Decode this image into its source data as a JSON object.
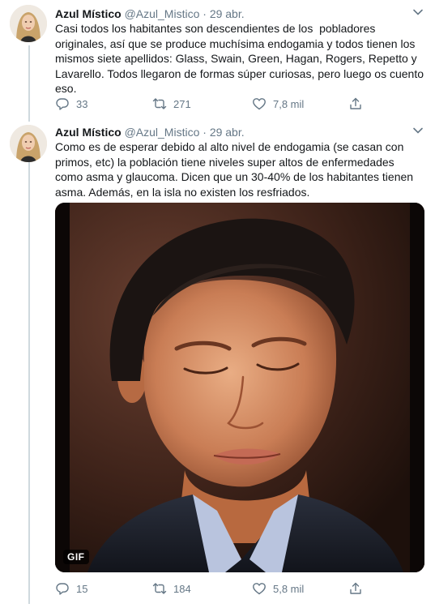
{
  "tweets": [
    {
      "name": "Azul Místico",
      "handle": "@Azul_Mistico",
      "dot": "·",
      "date": "29 abr.",
      "text": "Casi todos los habitantes son descendientes de los  pobladores\noriginales, así que se produce muchísima endogamia y todos tienen los\nmismos siete apellidos: Glass, Swain, Green, Hagan, Rogers, Repetto y\nLavarello. Todos llegaron de formas súper curiosas, pero luego os cuento\neso.",
      "replies": "33",
      "retweets": "271",
      "likes": "7,8 mil"
    },
    {
      "name": "Azul Místico",
      "handle": "@Azul_Mistico",
      "dot": "·",
      "date": "29 abr.",
      "text": "Como es de esperar debido al alto nivel de endogamia (se casan con\nprimos, etc) la población tiene niveles super altos de enfermedades\ncomo asma y glaucoma. Dicen que un 30-40% de los habitantes tienen\nasma. Además, en la isla no existen los resfriados.",
      "media_badge": "GIF",
      "replies": "15",
      "retweets": "184",
      "likes": "5,8 mil"
    }
  ],
  "icons": {
    "caret": "chevron-down-icon",
    "reply": "reply-icon",
    "retweet": "retweet-icon",
    "like": "heart-icon",
    "share": "share-icon"
  },
  "colors": {
    "secondary_text": "#657786",
    "thread_line": "#cfd9de"
  }
}
